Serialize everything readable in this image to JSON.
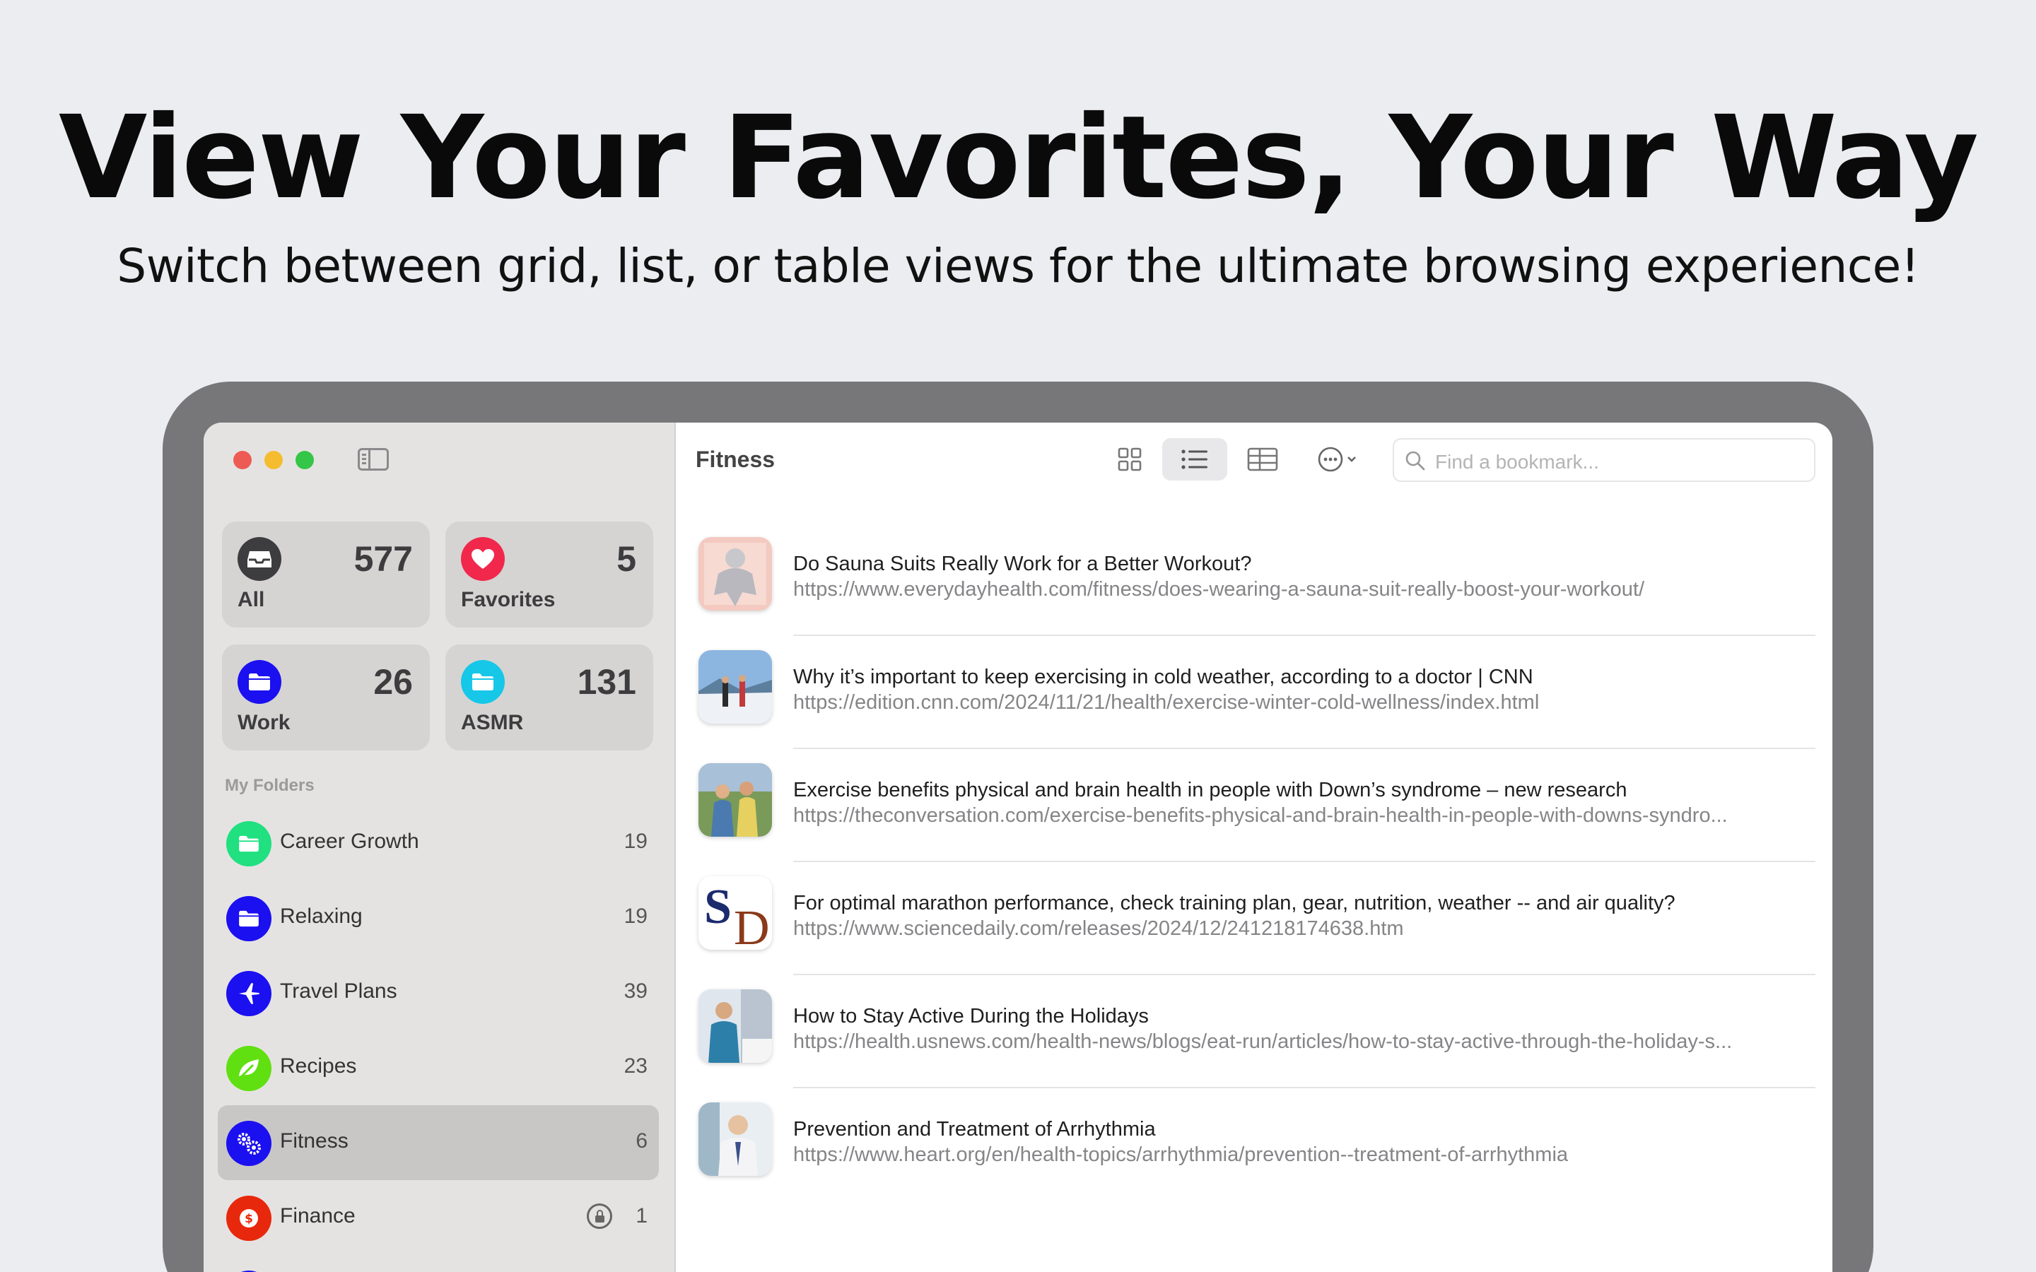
{
  "headline": "View Your Favorites, Your Way",
  "subheadline": "Switch between grid, list, or table views for the ultimate browsing experience!",
  "sidebar": {
    "tiles": [
      {
        "label": "All",
        "count": "577",
        "icon": "inbox-icon",
        "color": "#3d3d3f"
      },
      {
        "label": "Favorites",
        "count": "5",
        "icon": "heart-icon",
        "color": "#f1284c"
      },
      {
        "label": "Work",
        "count": "26",
        "icon": "folder-icon",
        "color": "#1b10f0"
      },
      {
        "label": "ASMR",
        "count": "131",
        "icon": "folder-icon",
        "color": "#16c7e8"
      }
    ],
    "section_label": "My Folders",
    "folders": [
      {
        "label": "Career Growth",
        "count": "19",
        "icon": "folder-icon",
        "color": "#20e080"
      },
      {
        "label": "Relaxing",
        "count": "19",
        "icon": "folder-icon",
        "color": "#1b10f0"
      },
      {
        "label": "Travel Plans",
        "count": "39",
        "icon": "airplane-icon",
        "color": "#1b10f0"
      },
      {
        "label": "Recipes",
        "count": "23",
        "icon": "leaf-icon",
        "color": "#60e010"
      },
      {
        "label": "Fitness",
        "count": "6",
        "icon": "gears-icon",
        "color": "#1b10f0",
        "selected": true
      },
      {
        "label": "Finance",
        "count": "1",
        "icon": "dollar-icon",
        "color": "#e8280c",
        "locked": true
      }
    ]
  },
  "main": {
    "title": "Fitness",
    "search_placeholder": "Find a bookmark...",
    "views": [
      "grid-view",
      "list-view",
      "table-view"
    ],
    "active_view": "list-view",
    "items": [
      {
        "title": "Do Sauna Suits Really Work for a Better Workout?",
        "url": "https://www.everydayhealth.com/fitness/does-wearing-a-sauna-suit-really-boost-your-workout/"
      },
      {
        "title": "Why it’s important to keep exercising in cold weather, according to a doctor | CNN",
        "url": "https://edition.cnn.com/2024/11/21/health/exercise-winter-cold-wellness/index.html"
      },
      {
        "title": "Exercise benefits physical and brain health in people with Down’s syndrome – new research",
        "url": "https://theconversation.com/exercise-benefits-physical-and-brain-health-in-people-with-downs-syndro..."
      },
      {
        "title": "For optimal marathon performance, check training plan, gear, nutrition, weather -- and air quality?",
        "url": "https://www.sciencedaily.com/releases/2024/12/241218174638.htm",
        "thumb_text_1": "S",
        "thumb_text_2": "D"
      },
      {
        "title": "How to Stay Active During the Holidays",
        "url": "https://health.usnews.com/health-news/blogs/eat-run/articles/how-to-stay-active-through-the-holiday-s..."
      },
      {
        "title": "Prevention and Treatment of Arrhythmia",
        "url": "https://www.heart.org/en/health-topics/arrhythmia/prevention--treatment-of-arrhythmia"
      }
    ]
  }
}
